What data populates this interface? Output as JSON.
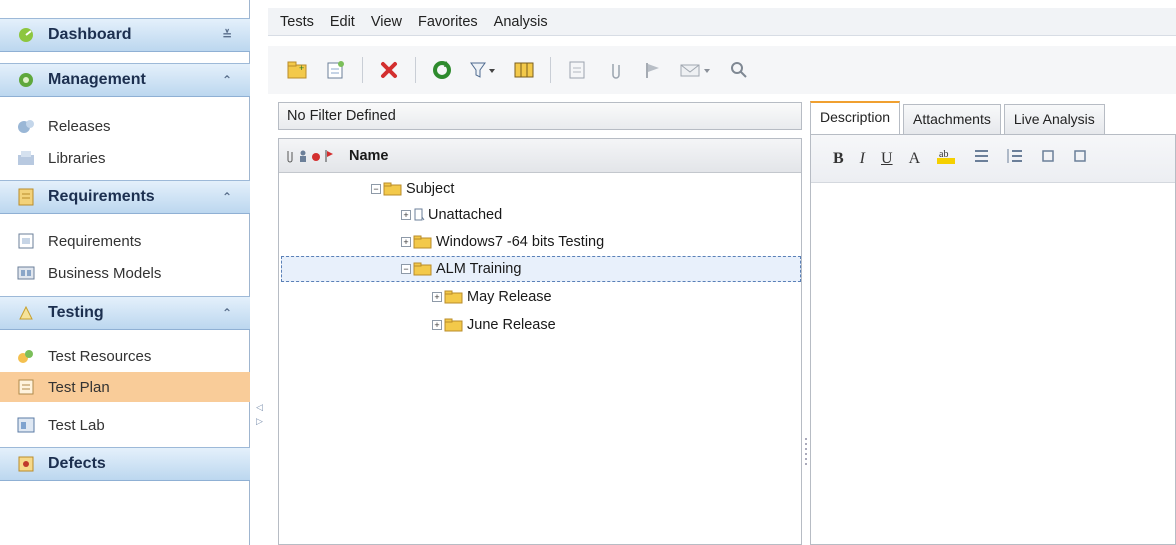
{
  "sidebar": {
    "dashboard": "Dashboard",
    "management": "Management",
    "releases": "Releases",
    "libraries": "Libraries",
    "requirements_header": "Requirements",
    "requirements": "Requirements",
    "business_models": "Business Models",
    "testing": "Testing",
    "test_resources": "Test Resources",
    "test_plan": "Test Plan",
    "test_lab": "Test Lab",
    "defects": "Defects"
  },
  "menubar": [
    "Tests",
    "Edit",
    "View",
    "Favorites",
    "Analysis"
  ],
  "filter": {
    "label": "No Filter Defined"
  },
  "tree": {
    "header": "Name",
    "nodes": {
      "subject": "Subject",
      "unattached": "Unattached",
      "windows7": "Windows7 -64 bits Testing",
      "alm_training": "ALM Training",
      "may_release": "May Release",
      "june_release": "June Release"
    }
  },
  "details": {
    "tabs": [
      "Description",
      "Attachments",
      "Live Analysis"
    ],
    "active_tab": "Description",
    "editor": [
      "B",
      "I",
      "U",
      "A"
    ]
  },
  "colors": {
    "accent": "#f9cc99",
    "header": "#bcd7ef",
    "folder": "#f3c94a"
  }
}
